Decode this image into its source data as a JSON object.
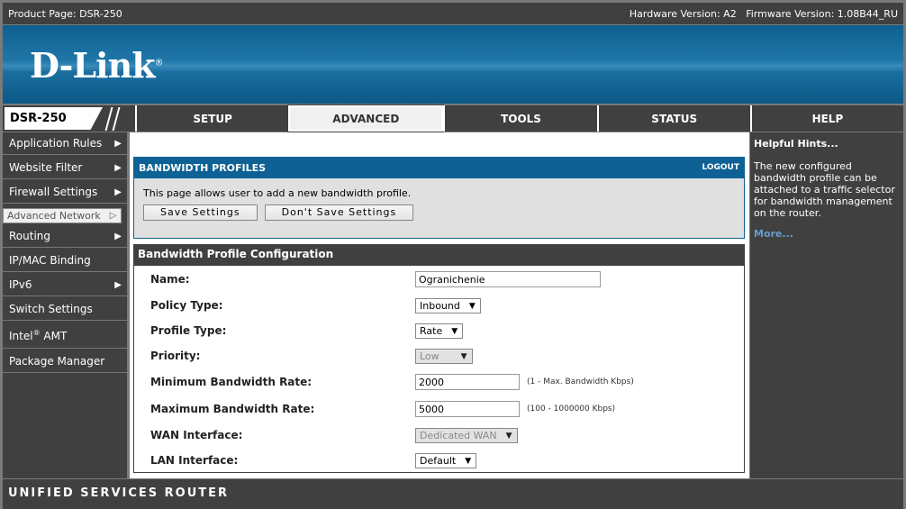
{
  "top": {
    "product": "Product Page: DSR-250",
    "hardware": "Hardware Version: A2",
    "firmware": "Firmware Version: 1.08B44_RU"
  },
  "logo": "D-Link",
  "nav": {
    "model": "DSR-250",
    "tabs": [
      "SETUP",
      "ADVANCED",
      "TOOLS",
      "STATUS",
      "HELP"
    ],
    "active": "ADVANCED"
  },
  "sidebar": [
    "Application Rules",
    "Website Filter",
    "Firewall Settings",
    "Advanced Network",
    "Routing",
    "IP/MAC Binding",
    "IPv6",
    "Switch Settings",
    "Intel",
    "Package Manager"
  ],
  "sidebar_sup": "®",
  "sidebar_amt": "AMT",
  "panel": {
    "title": "BANDWIDTH PROFILES",
    "logout": "LOGOUT",
    "desc": "This page allows user to add a new bandwidth profile.",
    "save": "Save Settings",
    "dont_save": "Don't Save Settings"
  },
  "config": {
    "title": "Bandwidth Profile Configuration",
    "name_label": "Name:",
    "name_value": "Ogranichenie",
    "policy_label": "Policy Type:",
    "policy_value": "Inbound",
    "profile_label": "Profile Type:",
    "profile_value": "Rate",
    "priority_label": "Priority:",
    "priority_value": "Low",
    "min_label": "Minimum Bandwidth Rate:",
    "min_value": "2000",
    "min_hint": "(1 - Max. Bandwidth Kbps)",
    "max_label": "Maximum Bandwidth Rate:",
    "max_value": "5000",
    "max_hint": "(100 - 1000000 Kbps)",
    "wan_label": "WAN Interface:",
    "wan_value": "Dedicated WAN",
    "lan_label": "LAN Interface:",
    "lan_value": "Default"
  },
  "help": {
    "title": "Helpful Hints...",
    "text": "The new configured bandwidth profile can be attached to a traffic selector for bandwidth management on the router.",
    "more": "More..."
  },
  "footer": "UNIFIED SERVICES ROUTER"
}
